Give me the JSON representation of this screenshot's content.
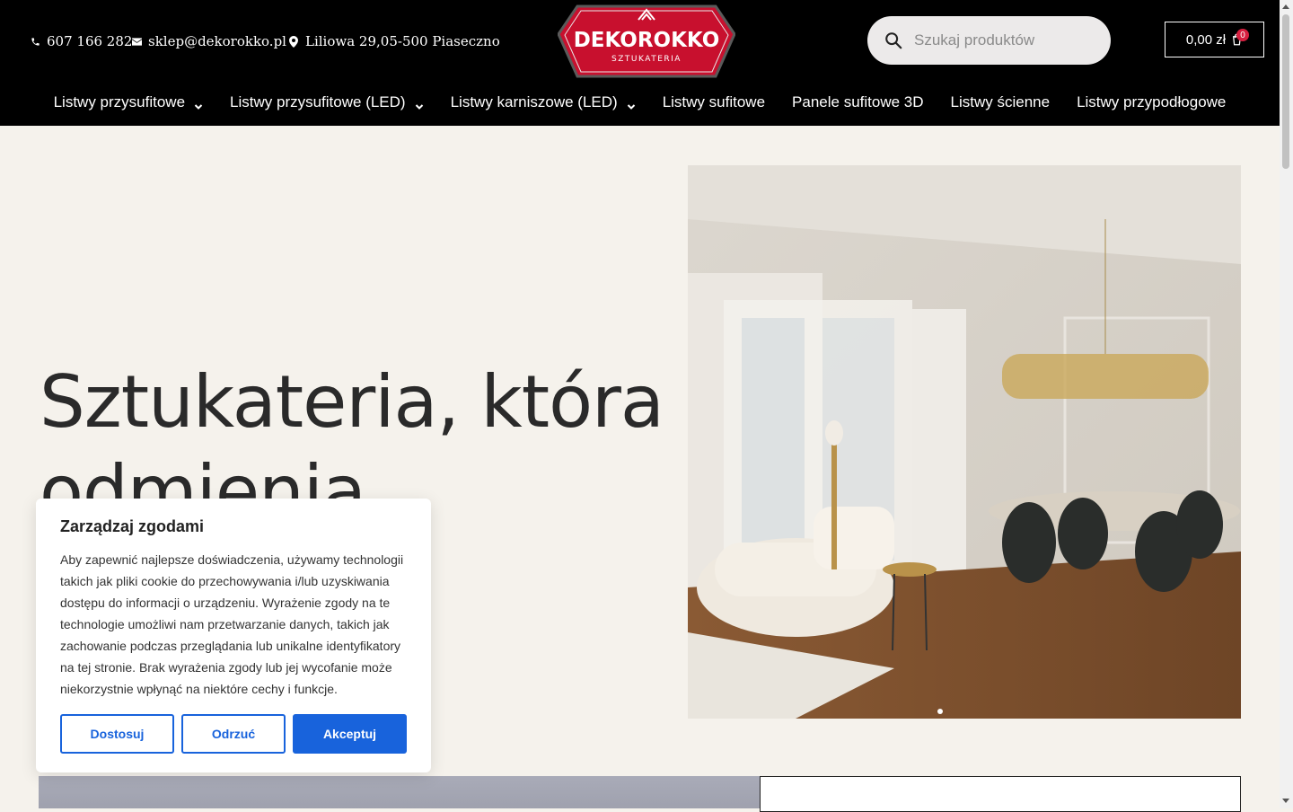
{
  "header": {
    "phone": "607 166 282",
    "email": "sklep@dekorokko.pl",
    "address": "Liliowa 29,05-500 Piaseczno",
    "logo": {
      "name": "DEKOROKKO",
      "tagline": "SZTUKATERIA"
    },
    "search": {
      "placeholder": "Szukaj produktów"
    },
    "cart": {
      "total": "0,00 zł",
      "count": "0"
    }
  },
  "nav": {
    "items": [
      {
        "label": "Listwy przysufitowe",
        "dropdown": true
      },
      {
        "label": "Listwy przysufitowe (LED)",
        "dropdown": true
      },
      {
        "label": "Listwy karniszowe (LED)",
        "dropdown": true
      },
      {
        "label": "Listwy sufitowe",
        "dropdown": false
      },
      {
        "label": "Panele sufitowe 3D",
        "dropdown": false
      },
      {
        "label": "Listwy ścienne",
        "dropdown": false
      },
      {
        "label": "Listwy przypodłogowe",
        "dropdown": false
      }
    ]
  },
  "hero": {
    "title": "Sztukateria, która odmienia wnętrza"
  },
  "cookie": {
    "title": "Zarządzaj zgodami",
    "text": "Aby zapewnić najlepsze doświadczenia, używamy technologii takich jak pliki cookie do przechowywania i/lub uzyskiwania dostępu do informacji o urządzeniu. Wyrażenie zgody na te technologie umożliwi nam przetwarzanie danych, takich jak zachowanie podczas przeglądania lub unikalne identyfikatory na tej stronie. Brak wyrażenia zgody lub jej wycofanie może niekorzystnie wpłynąć na niektóre cechy i funkcje.",
    "buttons": {
      "customize": "Dostosuj",
      "reject": "Odrzuć",
      "accept": "Akceptuj"
    }
  },
  "colors": {
    "brand": "#c8102e",
    "accent": "#1863dc",
    "header_bg": "#000000",
    "page_bg": "#f5f2ec"
  }
}
